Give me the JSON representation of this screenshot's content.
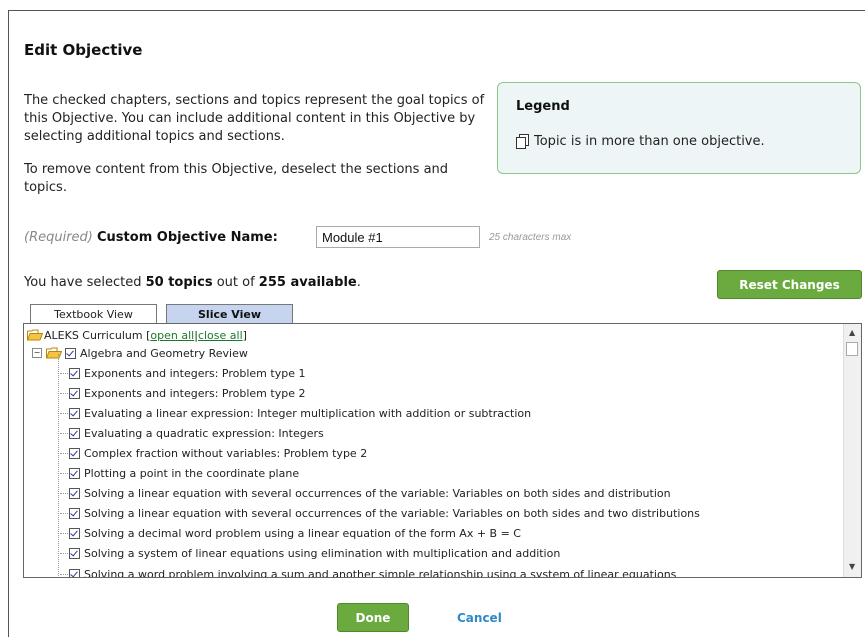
{
  "title": "Edit Objective",
  "description": {
    "para1": "The checked chapters, sections and topics represent the goal topics of this Objective. You can include additional content in this Objective by selecting additional topics and sections.",
    "para2": "To remove content from this Objective, deselect the sections and topics."
  },
  "legend": {
    "title": "Legend",
    "item": "Topic is in more than one objective.",
    "icon": "multi-objective-topic-icon"
  },
  "objective_name": {
    "required_label": "(Required)",
    "label": "Custom Objective Name:",
    "value": "Module #1",
    "hint": "25 characters max"
  },
  "selection": {
    "prefix": "You have selected",
    "topics": "50 topics",
    "middle": "out of",
    "available": "255 available",
    "suffix": "."
  },
  "reset_label": "Reset Changes",
  "tabs": [
    {
      "label": "Textbook View",
      "active": false
    },
    {
      "label": "Slice View",
      "active": true
    }
  ],
  "tree": {
    "root_label": "ALEKS Curriculum [",
    "open_all": "open all",
    "separator": " | ",
    "close_all": "close all",
    "root_end": "]",
    "chapter": "Algebra and Geometry Review",
    "topics": [
      "Exponents and integers: Problem type 1",
      "Exponents and integers: Problem type 2",
      "Evaluating a linear expression: Integer multiplication with addition or subtraction",
      "Evaluating a quadratic expression: Integers",
      "Complex fraction without variables: Problem type 2",
      "Plotting a point in the coordinate plane",
      "Solving a linear equation with several occurrences of the variable: Variables on both sides and distribution",
      "Solving a linear equation with several occurrences of the variable: Variables on both sides and two distributions",
      "Solving a decimal word problem using a linear equation of the form Ax + B = C",
      "Solving a system of linear equations using elimination with multiplication and addition",
      "Solving a word problem involving a sum and another simple relationship using a system of linear equations"
    ]
  },
  "done_label": "Done",
  "cancel_label": "Cancel",
  "colors": {
    "button_green": "#6aaa3e",
    "legend_bg": "#eef5f6",
    "legend_border": "#8cc78c",
    "active_tab": "#c6d4ef",
    "link_green": "#1a7a2a",
    "cancel_blue": "#2b8bc6"
  }
}
